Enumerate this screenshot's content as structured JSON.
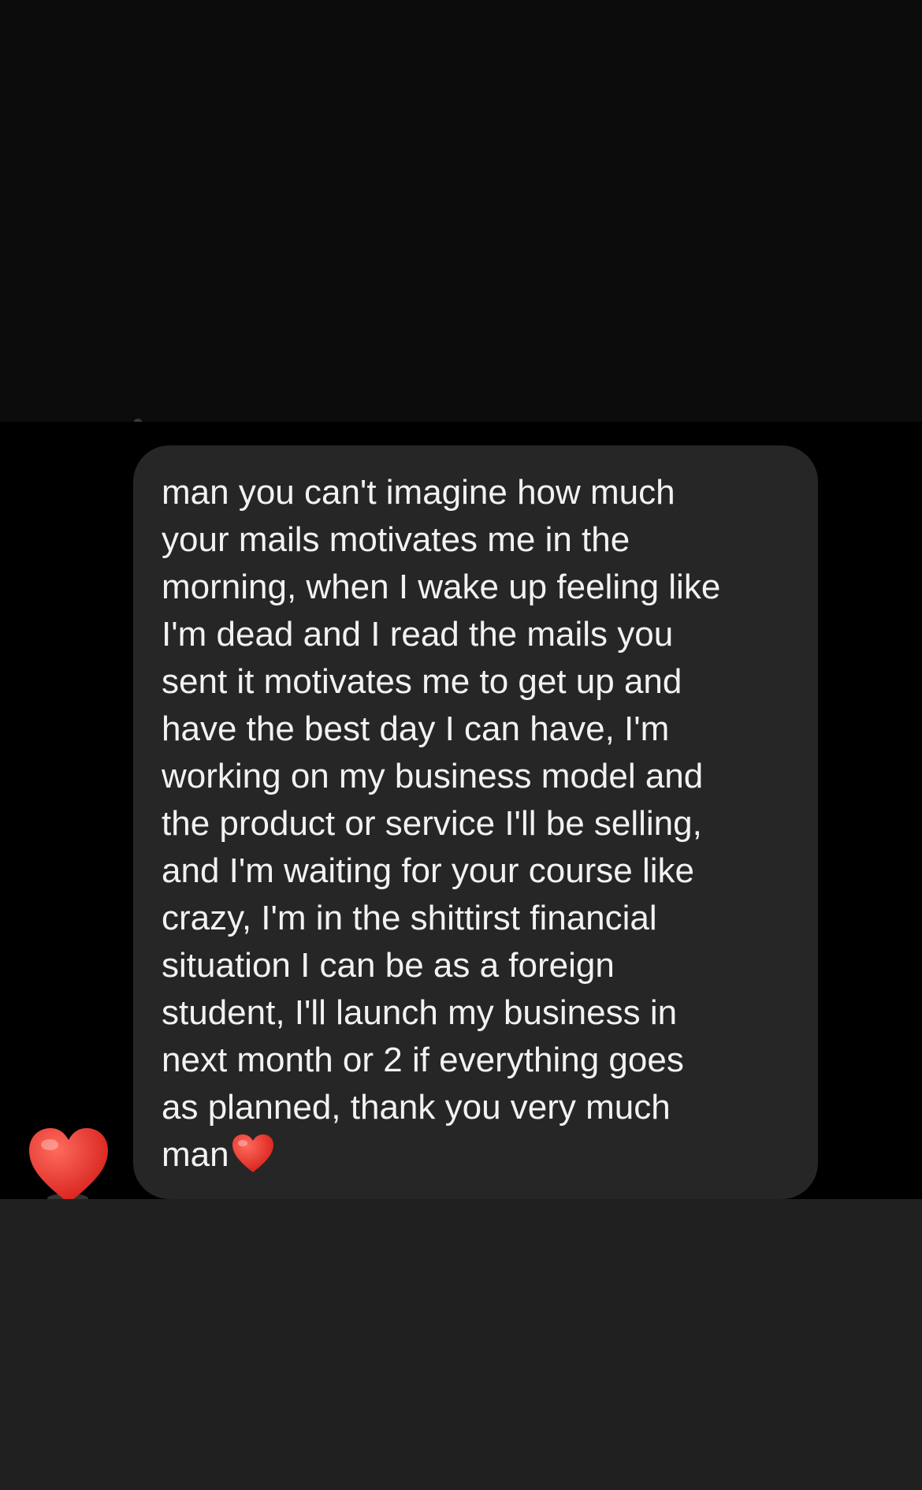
{
  "message": {
    "lines": [
      "man you can't imagine how much",
      "your mails motivates me in the",
      "morning, when I wake up feeling like",
      "I'm dead and I read the mails you",
      "sent it motivates me to get up and",
      "have the best day I can have, I'm",
      "working on my business model and",
      "the product or service I'll be selling,",
      "and I'm waiting for your course like",
      "crazy, I'm in the shittirst financial",
      "situation I can be as a foreign",
      "student, I'll launch my business in",
      "next month or 2 if everything goes",
      "as planned, thank you very much",
      "man"
    ],
    "inline_emoji": "red-heart-icon"
  },
  "reaction": {
    "emoji": "red-heart-icon"
  },
  "colors": {
    "background": "#000000",
    "top_area": "#0c0c0c",
    "bubble": "#262626",
    "text": "#f2f2f2",
    "heart": "#e8302a",
    "bottom_area": "#202020"
  }
}
